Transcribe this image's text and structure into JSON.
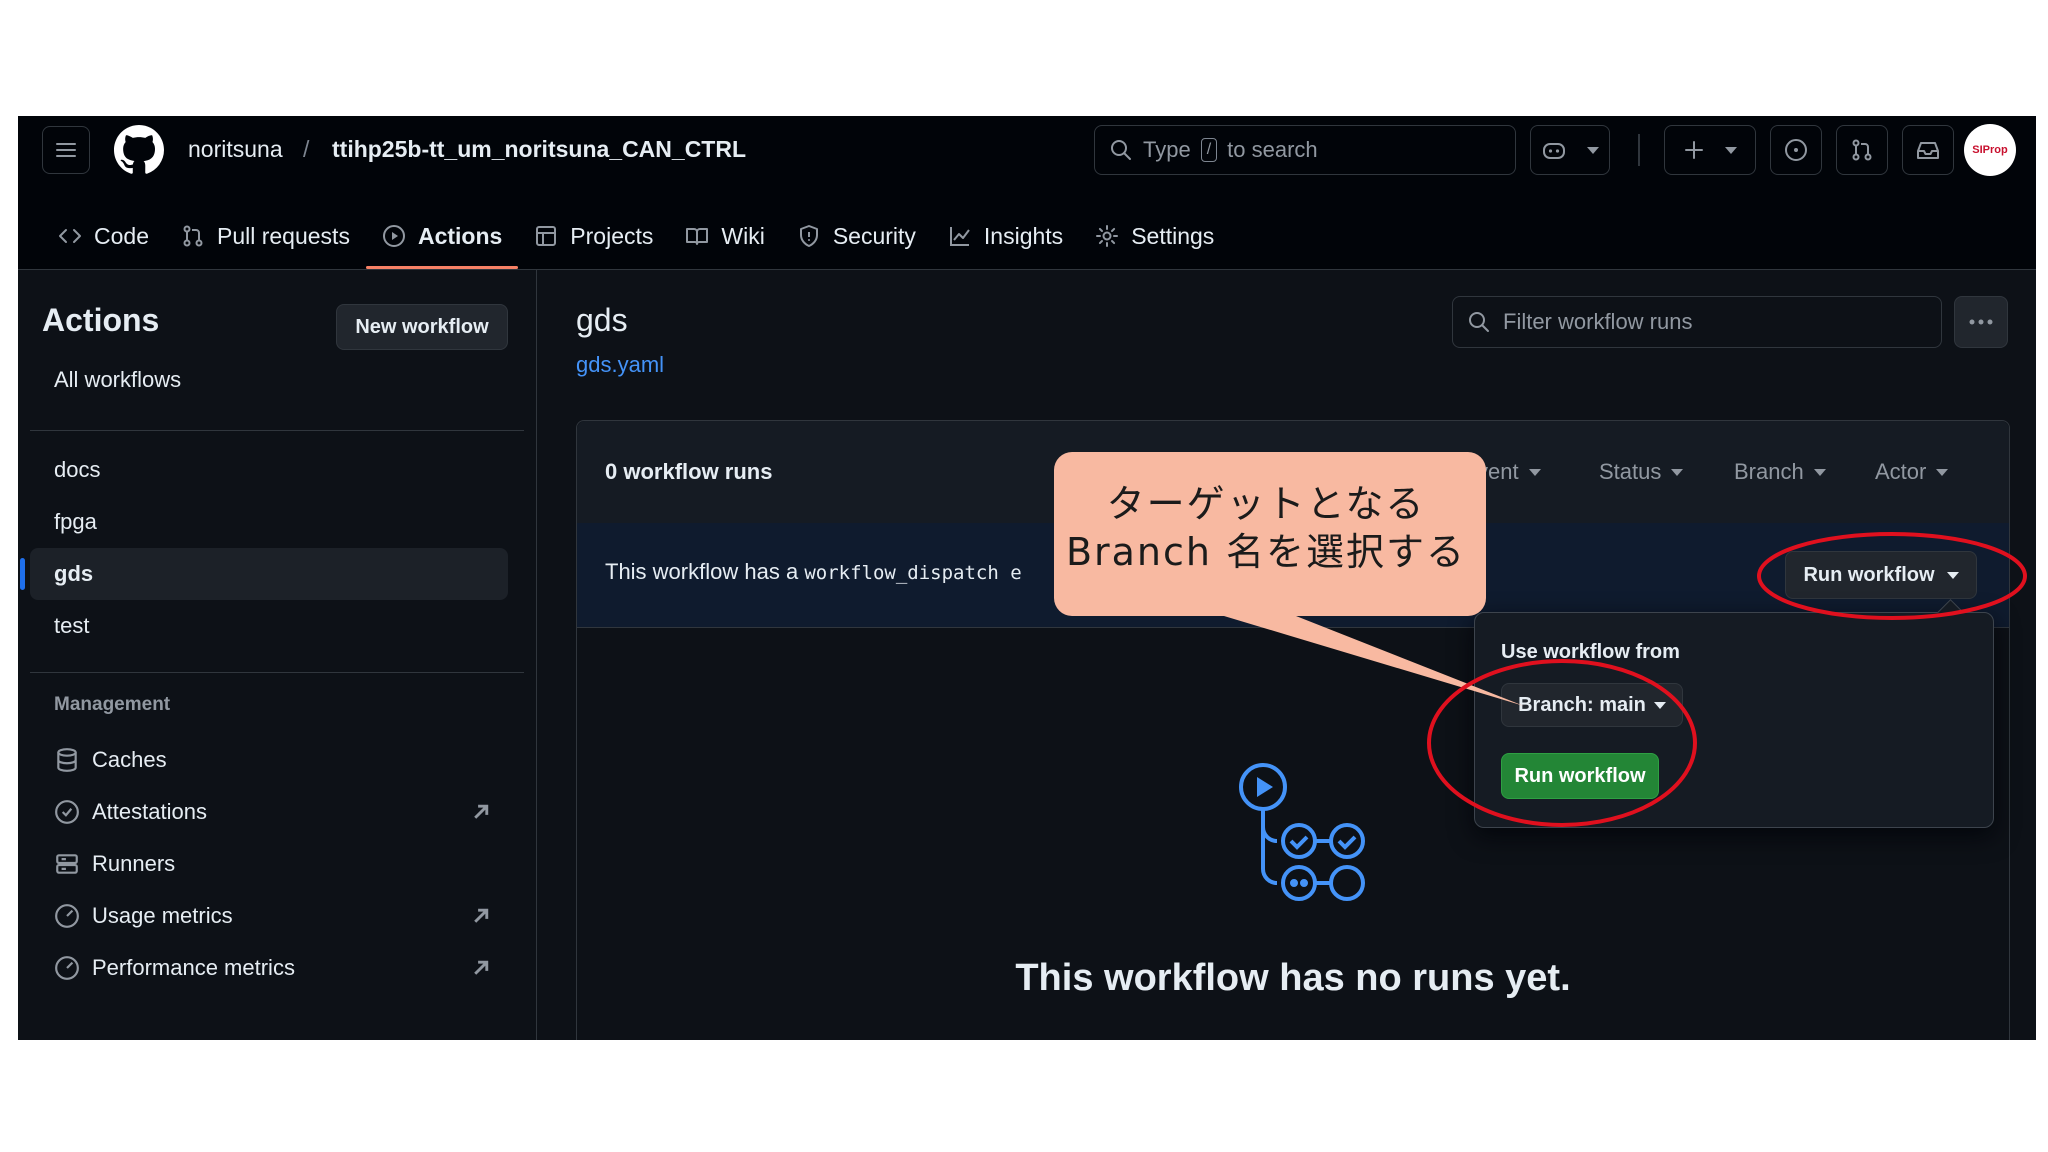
{
  "header": {
    "owner": "noritsuna",
    "separator": "/",
    "repo": "ttihp25b-tt_um_noritsuna_CAN_CTRL",
    "search_prefix": "Type",
    "search_key": "/",
    "search_suffix": "to search",
    "avatar_text": "SIProp"
  },
  "tabs": [
    {
      "label": "Code",
      "icon": "code-icon"
    },
    {
      "label": "Pull requests",
      "icon": "pull-request-icon"
    },
    {
      "label": "Actions",
      "icon": "play-icon",
      "active": true
    },
    {
      "label": "Projects",
      "icon": "table-icon"
    },
    {
      "label": "Wiki",
      "icon": "book-icon"
    },
    {
      "label": "Security",
      "icon": "shield-icon"
    },
    {
      "label": "Insights",
      "icon": "graph-icon"
    },
    {
      "label": "Settings",
      "icon": "gear-icon"
    }
  ],
  "sidebar": {
    "title": "Actions",
    "new_workflow": "New workflow",
    "all_workflows": "All workflows",
    "workflows": [
      "docs",
      "fpga",
      "gds",
      "test"
    ],
    "active_workflow": "gds",
    "management_heading": "Management",
    "management": [
      {
        "label": "Caches",
        "icon": "database-icon",
        "external": false
      },
      {
        "label": "Attestations",
        "icon": "verified-icon",
        "external": true
      },
      {
        "label": "Runners",
        "icon": "server-icon",
        "external": false
      },
      {
        "label": "Usage metrics",
        "icon": "meter-icon",
        "external": true
      },
      {
        "label": "Performance metrics",
        "icon": "meter-icon",
        "external": true
      }
    ]
  },
  "main": {
    "workflow_name": "gds",
    "workflow_file": "gds.yaml",
    "filter_placeholder": "Filter workflow runs",
    "runs_count": "0 workflow runs",
    "filters": [
      "vent",
      "Status",
      "Branch",
      "Actor"
    ],
    "dispatch_text": "This workflow has a",
    "dispatch_code": "workflow_dispatch e",
    "run_workflow_button": "Run workflow",
    "empty_text": "This workflow has no runs yet."
  },
  "dropdown": {
    "title": "Use workflow from",
    "branch_button": "Branch: main",
    "run_button": "Run workflow"
  },
  "annotation": {
    "callout_line1": "ターゲットとなる",
    "callout_line2": "Branch 名を選択する",
    "callout_color": "#f8b9a1",
    "highlight_color": "#e0101e"
  },
  "colors": {
    "background": "#0d1117",
    "header": "#010409",
    "accent_link": "#4493f8",
    "active_tab_underline": "#f78166",
    "primary_button": "#238636"
  }
}
